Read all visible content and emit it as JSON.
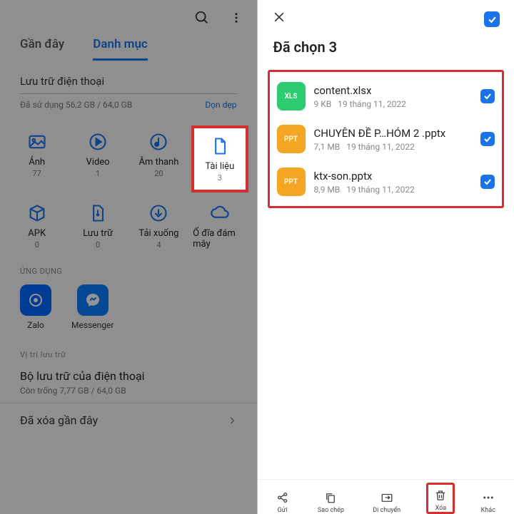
{
  "left": {
    "tabs": {
      "recent": "Gần đây",
      "category": "Danh mục"
    },
    "storage": {
      "title": "Lưu trữ điện thoại",
      "used": "Đã sử dụng 56,2 GB / 64,0 GB",
      "clean": "Dọn dẹp"
    },
    "categories": [
      {
        "label": "Ảnh",
        "count": "77"
      },
      {
        "label": "Video",
        "count": "1"
      },
      {
        "label": "Âm thanh",
        "count": "20"
      },
      {
        "label": "Tài liệu",
        "count": "3"
      },
      {
        "label": "APK",
        "count": "0"
      },
      {
        "label": "Lưu trữ",
        "count": "0"
      },
      {
        "label": "Tải xuống",
        "count": "4"
      },
      {
        "label": "Ổ đĩa đám mây",
        "count": ""
      }
    ],
    "apps_label": "ỨNG DỤNG",
    "apps": {
      "zalo": "Zalo",
      "messenger": "Messenger"
    },
    "loc_label": "Vị trí lưu trữ",
    "loc": {
      "title": "Bộ lưu trữ của điện thoại",
      "sub": "Còn trống 7,77 GB / 64,0 GB"
    },
    "deleted": "Đã xóa gần đây"
  },
  "right": {
    "selected": "Đã chọn 3",
    "files": [
      {
        "type": "XLS",
        "name": "content.xlsx",
        "size": "9 KB",
        "date": "19 tháng 11, 2022"
      },
      {
        "type": "PPT",
        "name": "CHUYÊN ĐỀ P…HÓM 2 .pptx",
        "size": "7,1 MB",
        "date": "19 tháng 11, 2022"
      },
      {
        "type": "PPT",
        "name": "ktx-son.pptx",
        "size": "8,9 MB",
        "date": "19 tháng 11, 2022"
      }
    ],
    "bar": {
      "send": "Gửi",
      "copy": "Sao chép",
      "move": "Di chuyển",
      "delete": "Xóa",
      "more": "Khác"
    }
  }
}
